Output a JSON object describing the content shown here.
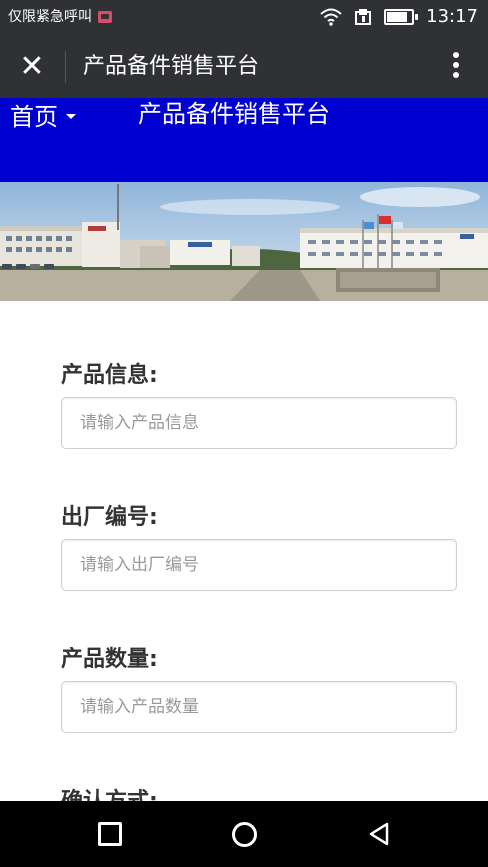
{
  "status_bar": {
    "carrier_text": "仅限紧急呼叫",
    "time": "13:17"
  },
  "app_bar": {
    "title": "产品备件销售平台",
    "close_icon": "close-icon",
    "more_icon": "more-vertical-icon"
  },
  "nav": {
    "home_label": "首页",
    "title": "产品备件销售平台"
  },
  "form": {
    "product_info": {
      "label": "产品信息:",
      "placeholder": "请输入产品信息"
    },
    "factory_number": {
      "label": "出厂编号:",
      "placeholder": "请输入出厂编号"
    },
    "quantity": {
      "label": "产品数量:",
      "placeholder": "请输入产品数量"
    },
    "confirm_method": {
      "label": "确认方式:"
    }
  },
  "colors": {
    "nav_blue": "#0000d0",
    "app_bar": "#2f3134"
  }
}
